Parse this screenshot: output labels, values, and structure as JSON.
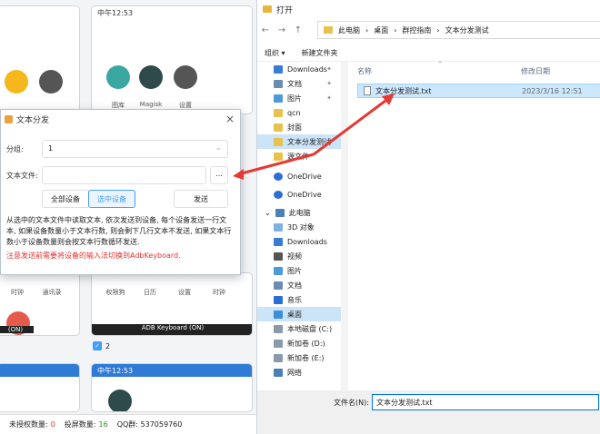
{
  "background": {
    "phone_times": [
      "中午12:53",
      "中午12:53"
    ],
    "app_labels": [
      "图库",
      "Magisk",
      "设置",
      "时钟",
      "通讯录",
      "权限狗",
      "日历",
      "设置",
      "时钟"
    ],
    "adb_label": "ADB Keyboard (ON)",
    "adb_label_left": "(ON)",
    "checkbox_value": "2",
    "status": {
      "unauthorized_label": "未授权数量:",
      "unauthorized_value": "0",
      "cast_label": "投屏数量:",
      "cast_value": "16",
      "qq_label": "QQ群:",
      "qq_value": "537059760"
    }
  },
  "text_dialog": {
    "title": "文本分发",
    "group_label": "分组:",
    "group_value": "1",
    "file_label": "文本文件:",
    "file_value": "",
    "browse_label": "...",
    "all_devices_label": "全部设备",
    "selected_devices_label": "选中设备",
    "send_label": "发送",
    "description": "从选中的文本文件中读取文本, 依次发送到设备, 每个设备发送一行文本, 如果设备数量小于文本行数, 则会剩下几行文本不发送, 如果文本行数小于设备数量则会按文本行数循环发送.",
    "warning": "注意发送前需要将设备的输入法切换到AdbKeyboard."
  },
  "open_dialog": {
    "title": "打开",
    "breadcrumb": [
      "此电脑",
      "桌面",
      "群控指南",
      "文本分发测试"
    ],
    "organize_label": "组织 ▾",
    "new_folder_label": "新建文件夹",
    "nav_items": [
      "Downloads",
      "文档",
      "图片",
      "qcn",
      "封面",
      "文本分发测试",
      "源文件",
      "OneDrive",
      "OneDrive",
      "此电脑",
      "3D 对象",
      "Downloads",
      "视频",
      "图片",
      "文档",
      "音乐",
      "桌面",
      "本地磁盘 (C:)",
      "新加卷 (D:)",
      "新加卷 (E:)",
      "网络"
    ],
    "col_name": "名称",
    "col_date": "修改日期",
    "files": [
      {
        "name": "文本分发测试.txt",
        "date": "2023/3/16 12:51"
      }
    ],
    "filename_label": "文件名(N):",
    "filename_value": "文本分发测试.txt"
  },
  "colors": {
    "accent": "#409eff",
    "warning": "#e03030",
    "arrow": "#e53935",
    "selection": "#cce8ff"
  }
}
